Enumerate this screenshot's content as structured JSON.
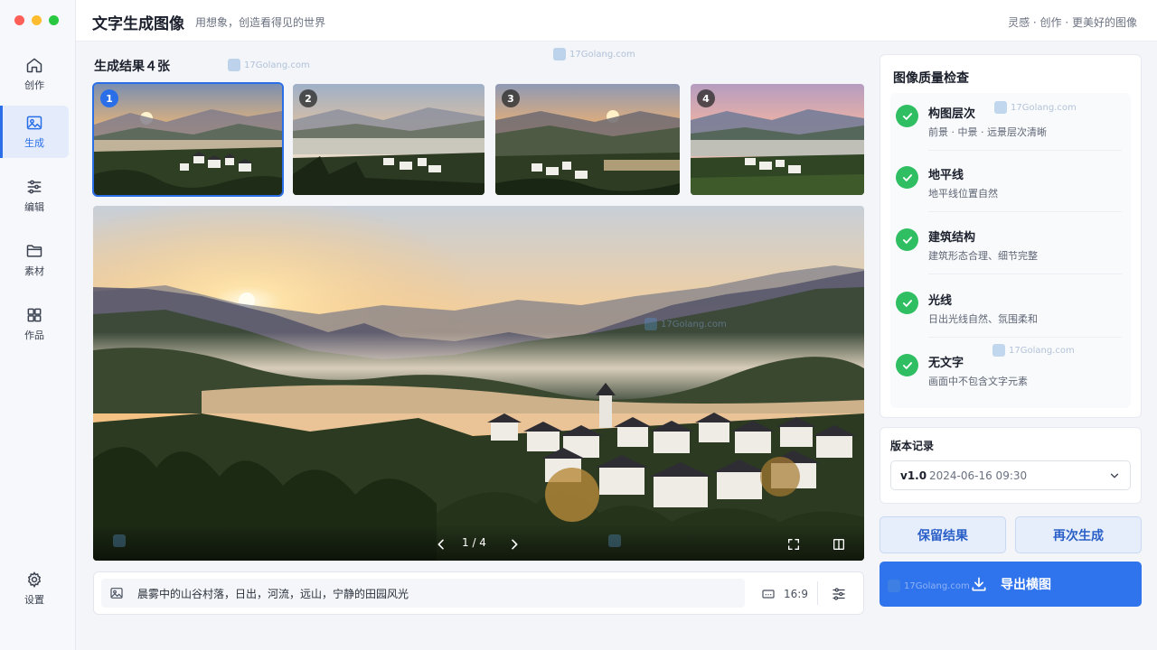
{
  "header": {
    "title": "文字生成图像",
    "subtitle": "用想象，创造看得见的世界",
    "tagline": "灵感 · 创作 · 更美好的图像"
  },
  "sidebar": {
    "items": [
      {
        "label": "创作",
        "icon": "home-icon"
      },
      {
        "label": "生成",
        "icon": "image-icon"
      },
      {
        "label": "编辑",
        "icon": "sliders-icon"
      },
      {
        "label": "素材",
        "icon": "folder-icon"
      },
      {
        "label": "作品",
        "icon": "grid-icon"
      }
    ],
    "settings": {
      "label": "设置",
      "icon": "gear-icon"
    }
  },
  "results": {
    "title": "生成结果４张",
    "thumbnails": [
      {
        "number": "1",
        "selected": true
      },
      {
        "number": "2",
        "selected": false
      },
      {
        "number": "3",
        "selected": false
      },
      {
        "number": "4",
        "selected": false
      }
    ]
  },
  "preview": {
    "page_indicator": "1 / 4"
  },
  "prompt": {
    "text": "晨雾中的山谷村落，日出，河流，远山，宁静的田园风光",
    "aspect_ratio": "16:9"
  },
  "quality": {
    "title": "图像质量检查",
    "items": [
      {
        "name": "构图层次",
        "desc": "前景 · 中景 · 远景层次清晰"
      },
      {
        "name": "地平线",
        "desc": "地平线位置自然"
      },
      {
        "name": "建筑结构",
        "desc": "建筑形态合理、细节完整"
      },
      {
        "name": "光线",
        "desc": "日出光线自然、氛围柔和"
      },
      {
        "name": "无文字",
        "desc": "画面中不包含文字元素"
      }
    ]
  },
  "version": {
    "title": "版本记录",
    "name": "v1.0",
    "date": "2024-06-16 09:30"
  },
  "actions": {
    "keep": "保留结果",
    "regenerate": "再次生成",
    "export": "导出横图"
  },
  "watermark": "17Golang.com",
  "colors": {
    "accent": "#2f74ec",
    "success": "#2fbf62"
  }
}
